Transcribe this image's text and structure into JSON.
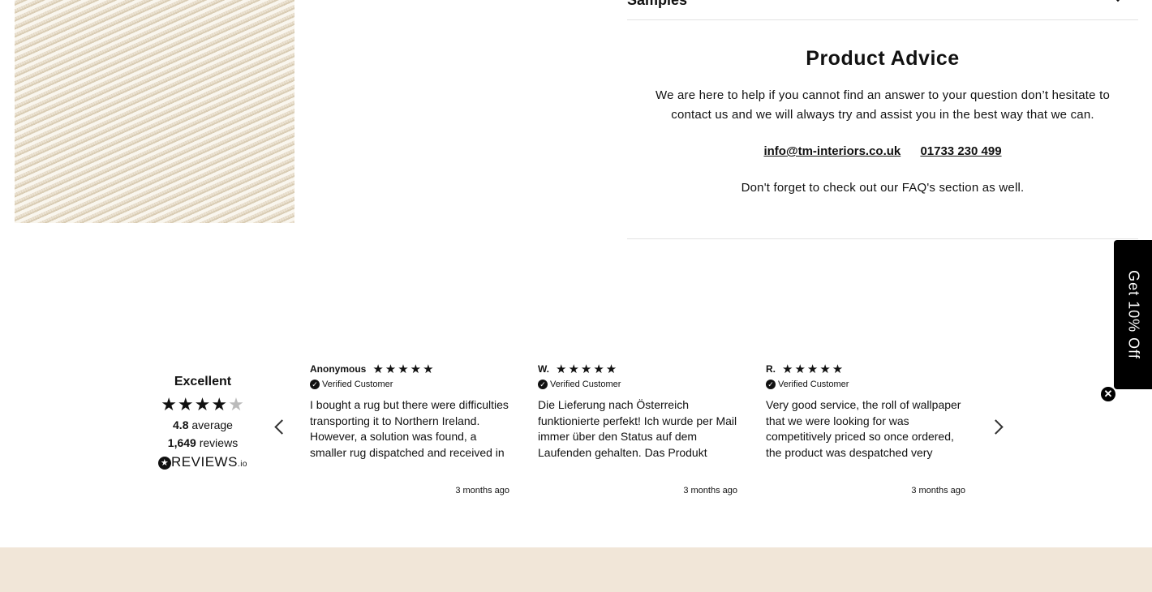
{
  "accordion": {
    "samples_label": "Samples"
  },
  "advice": {
    "title": "Product Advice",
    "body": "We are here to help if you cannot find an answer to your question don’t hesitate to contact us and we will always try and assist you in the best way that we can.",
    "email": "info@tm-interiors.co.uk",
    "phone": "01733 230 499",
    "faq_note": "Don't forget to check out our FAQ's section as well."
  },
  "promo": {
    "label": "Get 10% Off",
    "close_icon": "close-icon"
  },
  "reviews_summary": {
    "label": "Excellent",
    "rating": 4.8,
    "stars": "★★★★",
    "half_star": "★",
    "average_value": "4.8",
    "average_label": "average",
    "count_value": "1,649",
    "count_label": "reviews",
    "logo_text": "REVIEWS",
    "logo_suffix": ".io"
  },
  "reviews": [
    {
      "name": "Anonymous",
      "rating": 5,
      "stars": "★★★★★",
      "verified": "Verified Customer",
      "text": "I bought a rug but there were difficulties transporting it to Northern Ireland. However, a solution was found, a smaller rug dispatched and received in two days. Attentive service with real…",
      "date": "3 months ago"
    },
    {
      "name": "W.",
      "rating": 5,
      "stars": "★★★★★",
      "verified": "Verified Customer",
      "text": "Die Lieferung nach Österreich funktionierte perfekt! Ich wurde per Mail immer über den Status auf dem Laufenden gehalten. Das Produkt entspricht genau meinen…",
      "date": "3 months ago"
    },
    {
      "name": "R.",
      "rating": 5,
      "stars": "★★★★★",
      "verified": "Verified Customer",
      "text": "Very good service, the roll of wallpaper that we were looking for was competitively priced so once ordered, the product was despatched very promptly and delivered in good…",
      "date": "3 months ago"
    }
  ],
  "icons": {
    "verified": "verified-check-icon",
    "prev": "chevron-left-icon",
    "next": "chevron-right-icon",
    "accordion": "chevron-down-icon"
  },
  "colors": {
    "footer_band": "#f1e6d8",
    "promo_bg": "#000000"
  }
}
